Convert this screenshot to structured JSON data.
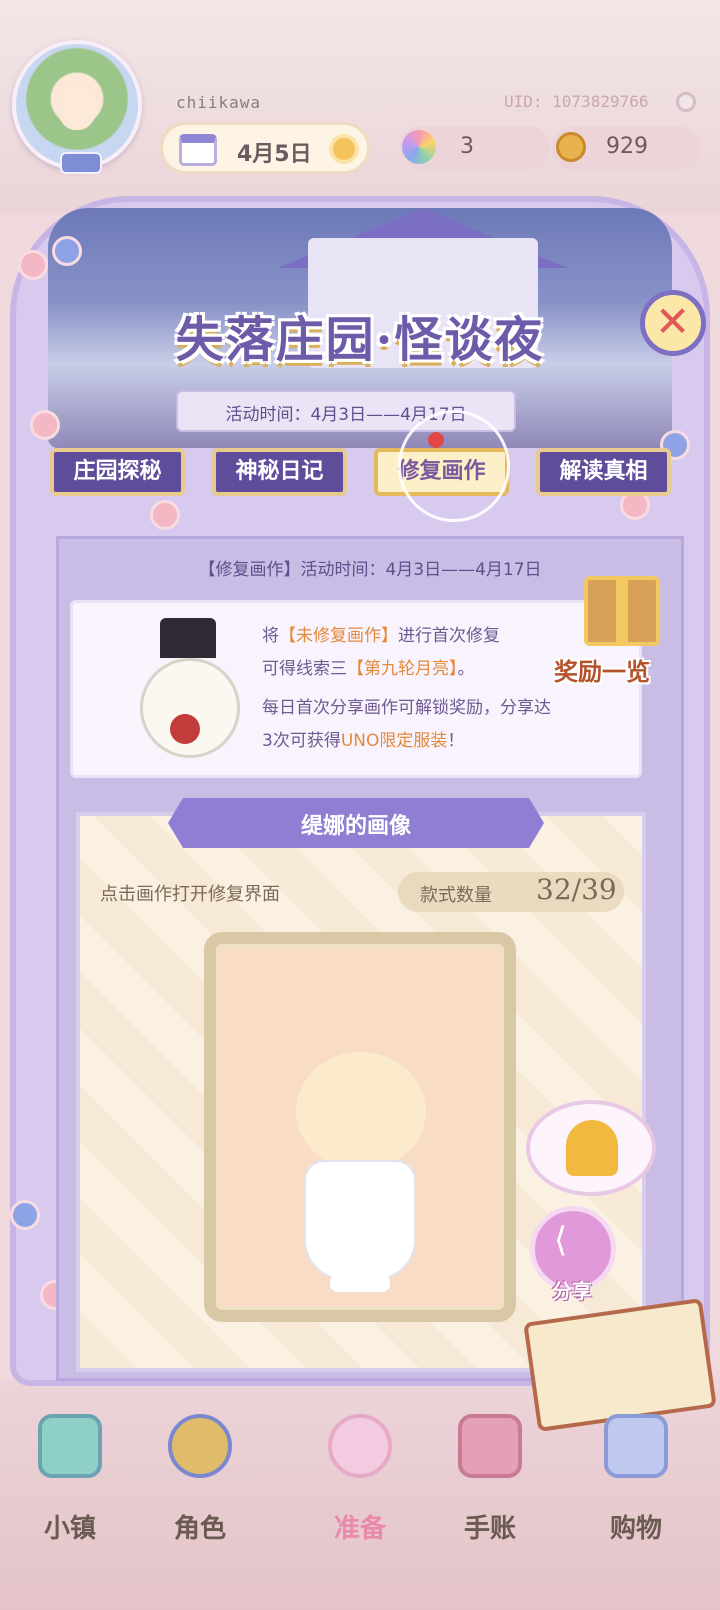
{
  "header": {
    "username": "chiikawa",
    "uid": "UID: 1073829766",
    "date": "4月5日",
    "flower_count": "3",
    "coin_count": "929"
  },
  "banner": {
    "title": "失落庄园·怪谈夜",
    "activity_time": "活动时间：4月3日——4月17日"
  },
  "tabs": [
    {
      "label": "庄园探秘"
    },
    {
      "label": "神秘日记"
    },
    {
      "label": "修复画作"
    },
    {
      "label": "解读真相"
    }
  ],
  "active_tab": "修复画作",
  "section": {
    "subtitle": "【修复画作】活动时间：4月3日——4月17日",
    "info_line1_a": "将",
    "info_line1_hl": "【未修复画作】",
    "info_line1_b": "进行首次修复",
    "info_line2_a": "可得线索三",
    "info_line2_hl": "【第九轮月亮】",
    "info_line2_b": "。",
    "info_line3": "每日首次分享画作可解锁奖励，分享达",
    "info_line4_a": "3次可获得",
    "info_line4_hl": "UNO限定服装",
    "info_line4_b": "！",
    "reward_label": "奖励一览"
  },
  "portrait": {
    "title": "缇娜的画像",
    "hint": "点击画作打开修复界面",
    "count_label": "款式数量",
    "count_value": "32/39",
    "share_label": "分享"
  },
  "nav": [
    {
      "label": "小镇",
      "icon": "map-icon"
    },
    {
      "label": "角色",
      "icon": "character-icon"
    },
    {
      "label": "准备",
      "icon": "prepare-icon"
    },
    {
      "label": "手账",
      "icon": "journal-icon"
    },
    {
      "label": "购物",
      "icon": "shopping-bag-icon"
    }
  ],
  "colors": {
    "accent_purple": "#5f4d9c",
    "highlight_orange": "#e48a3f",
    "close_red": "#e25757"
  }
}
